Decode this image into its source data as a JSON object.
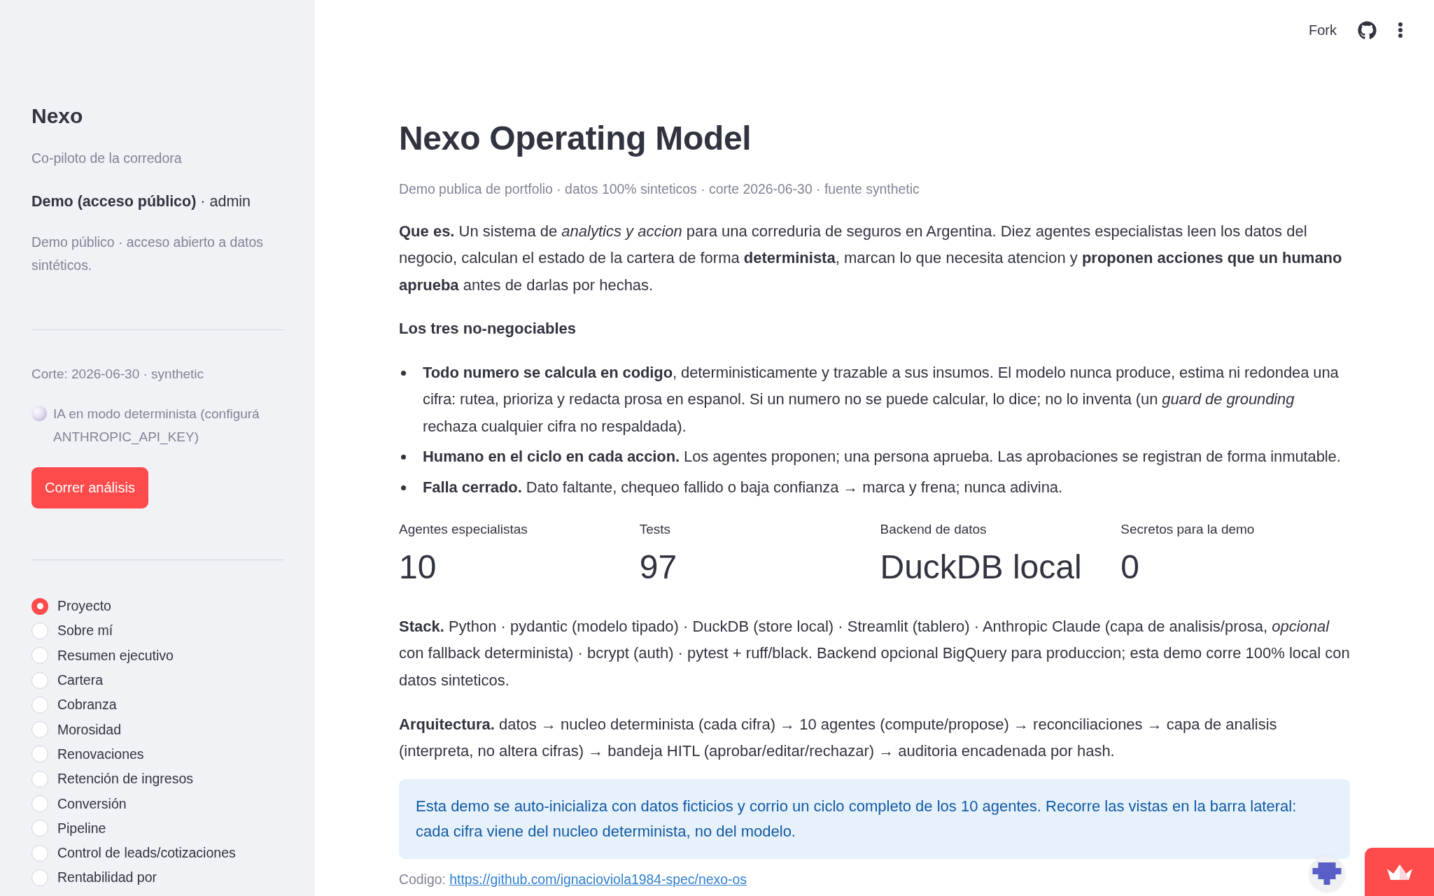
{
  "header": {
    "fork_label": "Fork"
  },
  "sidebar": {
    "title": "Nexo",
    "subtitle": "Co-piloto de la corredora",
    "user": "**Demo (acceso público)** · admin",
    "note": "Demo público · acceso abierto a datos sintéticos.",
    "cutoff": "Corte: 2026-06-30 · synthetic",
    "ai_status": "IA en modo determinista (configurá ANTHROPIC_API_KEY)",
    "run_button": "Correr análisis",
    "nav": [
      {
        "label": "Proyecto",
        "selected": true
      },
      {
        "label": "Sobre mí",
        "selected": false
      },
      {
        "label": "Resumen ejecutivo",
        "selected": false
      },
      {
        "label": "Cartera",
        "selected": false
      },
      {
        "label": "Cobranza",
        "selected": false
      },
      {
        "label": "Morosidad",
        "selected": false
      },
      {
        "label": "Renovaciones",
        "selected": false
      },
      {
        "label": "Retención de ingresos",
        "selected": false
      },
      {
        "label": "Conversión",
        "selected": false
      },
      {
        "label": "Pipeline",
        "selected": false
      },
      {
        "label": "Control de leads/cotizaciones",
        "selected": false
      },
      {
        "label": "Rentabilidad por",
        "selected": false
      }
    ]
  },
  "main": {
    "title": "Nexo Operating Model",
    "caption": "Demo publica de portfolio · datos 100% sinteticos · corte 2026-06-30 · fuente synthetic",
    "intro": "**Que es.** Un sistema de *analytics y accion* para una correduria de seguros en Argentina. Diez agentes especialistas leen los datos del negocio, calculan el estado de la cartera de forma **determinista**, marcan lo que necesita atencion y **proponen acciones que un humano aprueba** antes de darlas por hechas.",
    "principles_heading": "Los tres no-negociables",
    "principles": [
      "**Todo numero se calcula en codigo**, deterministicamente y trazable a sus insumos. El modelo nunca produce, estima ni redondea una cifra: rutea, prioriza y redacta prosa en espanol. Si un numero no se puede calcular, lo dice; no lo inventa (un *guard de grounding* rechaza cualquier cifra no respaldada).",
      "**Humano en el ciclo en cada accion.** Los agentes proponen; una persona aprueba. Las aprobaciones se registran de forma inmutable.",
      "**Falla cerrado.** Dato faltante, chequeo fallido o baja confianza → marca y frena; nunca adivina."
    ],
    "metrics": [
      {
        "label": "Agentes especialistas",
        "value": "10"
      },
      {
        "label": "Tests",
        "value": "97"
      },
      {
        "label": "Backend de datos",
        "value": "DuckDB local"
      },
      {
        "label": "Secretos para la demo",
        "value": "0"
      }
    ],
    "stack": "**Stack.** Python · pydantic (modelo tipado) · DuckDB (store local) · Streamlit (tablero) · Anthropic Claude (capa de analisis/prosa, *opcional* con fallback determinista) · bcrypt (auth) · pytest + ruff/black. Backend opcional BigQuery para produccion; esta demo corre 100% local con datos sinteticos.",
    "architecture": "**Arquitectura.** datos → nucleo determinista (cada cifra) → 10 agentes (compute/propose) → reconciliaciones → capa de analisis (interpreta, no altera cifras) → bandeja HITL (aprobar/editar/rechazar) → auditoria encadenada por hash.",
    "info": "Esta demo se auto-inicializa con datos ficticios y corrio un ciclo completo de los 10 agentes. Recorre las vistas en la barra lateral: cada cifra viene del nucleo determinista, no del modelo.",
    "code_line": {
      "label": "Codigo:",
      "link": "https://github.com/ignacioviola1984-spec/nexo-os"
    }
  }
}
